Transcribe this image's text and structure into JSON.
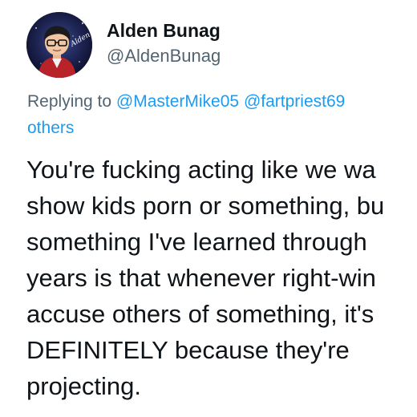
{
  "author": {
    "display_name": "Alden Bunag",
    "handle": "@AldenBunag",
    "avatar_signature": "Alden"
  },
  "reply_context": {
    "prefix": "Replying to",
    "mentions": [
      "@MasterMike05",
      "@fartpriest69"
    ],
    "others_label": "others"
  },
  "tweet": {
    "lines": [
      "You're fucking acting like we wa",
      "show kids porn or something, bu",
      "something I've learned through",
      "years is that whenever right-win",
      "accuse others of something, it's",
      "DEFINITELY because they're",
      "projecting."
    ]
  },
  "colors": {
    "text": "#0f1419",
    "secondary": "#536471",
    "link": "#1d9bf0",
    "background": "#ffffff"
  }
}
